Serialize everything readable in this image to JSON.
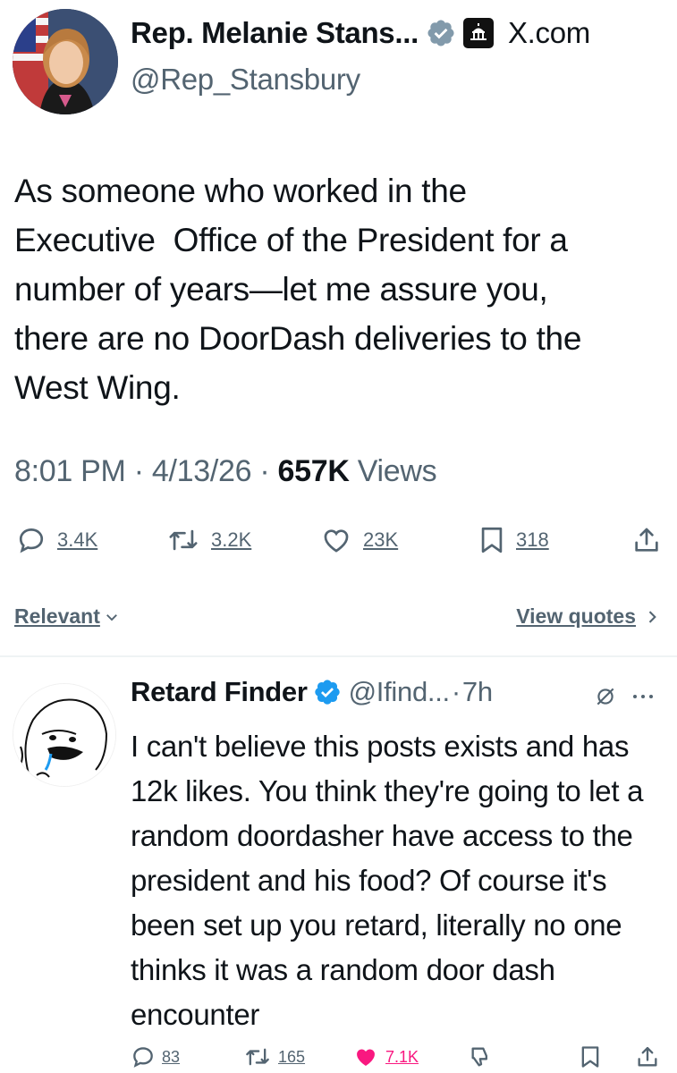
{
  "tweet": {
    "display_name": "Rep. Melanie Stans...",
    "site_label": "X.com",
    "handle": "@Rep_Stansbury",
    "text": "As someone who worked in the\nExecutive  Office of the President for a\nnumber of years—let me assure you,\nthere are no DoorDash deliveries to the\nWest Wing.",
    "time": "8:01 PM",
    "date": "4/13/26",
    "views_count": "657K",
    "views_label": "Views",
    "replies": "3.4K",
    "reposts": "3.2K",
    "likes": "23K",
    "bookmarks": "318"
  },
  "sort": {
    "relevant_label": "Relevant",
    "view_quotes_label": "View quotes"
  },
  "reply": {
    "display_name": "Retard Finder",
    "handle": "@Ifind...",
    "time": "7h",
    "text": "I can't believe this posts exists and has 12k likes.  You think they're going to let a random doordasher have access to the president and his food? Of course it's been set up you retard, literally no one thinks it was a random door dash encounter",
    "replies": "83",
    "reposts": "165",
    "likes": "7.1K"
  },
  "colors": {
    "text": "#0f1419",
    "muted": "#536471",
    "verified_blue": "#1d9bf0",
    "verified_gray": "#829aab",
    "like_pink": "#f91880"
  }
}
